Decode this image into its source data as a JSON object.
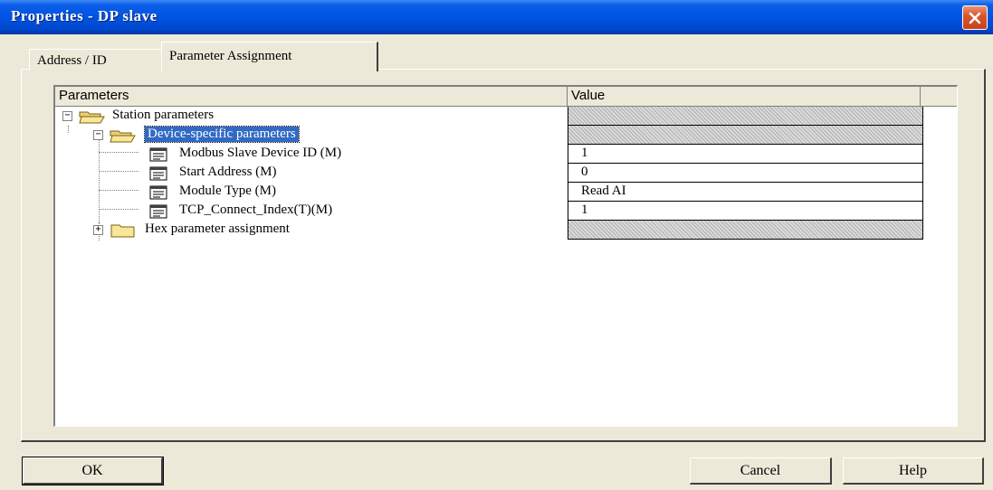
{
  "window": {
    "title": "Properties - DP slave"
  },
  "tabs": [
    {
      "label": "Address / ID",
      "active": false
    },
    {
      "label": "Parameter Assignment",
      "active": true
    }
  ],
  "grid": {
    "columns": [
      "Parameters",
      "Value"
    ],
    "rows": [
      {
        "name": "Station parameters",
        "value": "",
        "icon": "folder-open-icon",
        "expander": "minus",
        "hatched": true,
        "selected": false
      },
      {
        "name": "Device-specific parameters",
        "value": "",
        "icon": "folder-open-icon",
        "expander": "minus",
        "hatched": true,
        "selected": true
      },
      {
        "name": "Modbus Slave Device ID (M)",
        "value": "1",
        "icon": "parameter-icon",
        "expander": "",
        "hatched": false,
        "selected": false
      },
      {
        "name": "Start Address (M)",
        "value": "0",
        "icon": "parameter-icon",
        "expander": "",
        "hatched": false,
        "selected": false
      },
      {
        "name": "Module Type (M)",
        "value": "Read AI",
        "icon": "parameter-icon",
        "expander": "",
        "hatched": false,
        "selected": false
      },
      {
        "name": "TCP_Connect_Index(T)(M)",
        "value": "1",
        "icon": "parameter-icon",
        "expander": "",
        "hatched": false,
        "selected": false
      },
      {
        "name": "Hex parameter assignment",
        "value": "",
        "icon": "folder-closed-icon",
        "expander": "plus",
        "hatched": true,
        "selected": false
      }
    ]
  },
  "buttons": {
    "ok": "OK",
    "cancel": "Cancel",
    "help": "Help"
  },
  "colors": {
    "titlebar": "#0054e3",
    "selection": "#316ac5",
    "dialog_bg": "#ece9d8",
    "close": "#d8572f"
  }
}
